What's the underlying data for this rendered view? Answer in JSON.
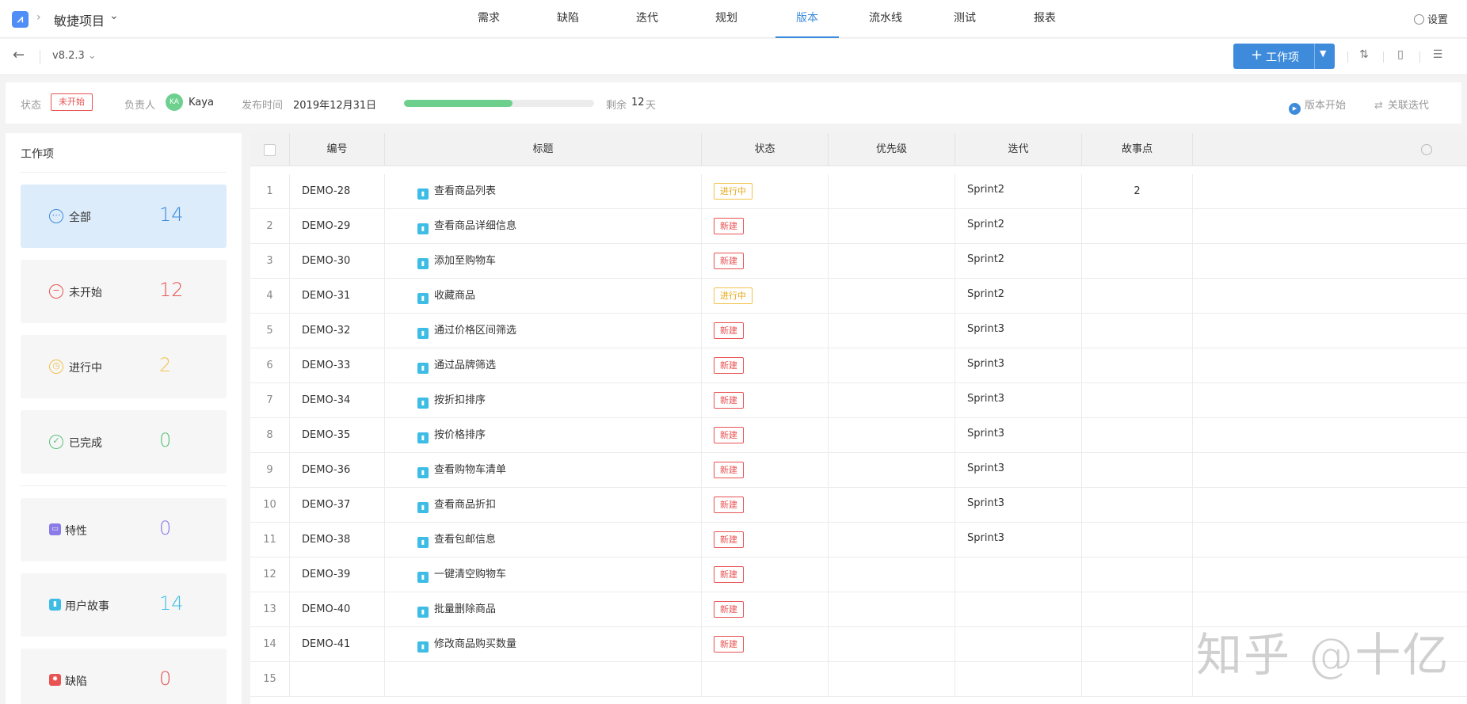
{
  "project": {
    "name": "敏捷项目"
  },
  "nav": [
    "需求",
    "缺陷",
    "迭代",
    "规划",
    "版本",
    "流水线",
    "测试",
    "报表"
  ],
  "nav_active": "版本",
  "settings_label": "设置",
  "version": {
    "label": "v8.2.3"
  },
  "toolbar": {
    "add_workitem_label": "工作项"
  },
  "info": {
    "status_label": "状态",
    "status_value": "未开始",
    "owner_label": "负责人",
    "owner_initials": "KA",
    "owner_name": "Kaya",
    "release_label": "发布时间",
    "release_date": "2019年12月31日",
    "progress": 0.57,
    "remaining_prefix": "剩余",
    "remaining_value": "12",
    "remaining_unit": "天",
    "start_action": "版本开始",
    "link_action": "关联迭代"
  },
  "left": {
    "title": "工作项",
    "cards": [
      {
        "label": "全部",
        "count": "14",
        "icon": "more-circle-icon",
        "color": "#3d8bda"
      },
      {
        "label": "未开始",
        "count": "12",
        "icon": "minus-circle-icon",
        "color": "#e85252"
      },
      {
        "label": "进行中",
        "count": "2",
        "icon": "clock-icon",
        "color": "#f2c34b"
      },
      {
        "label": "已完成",
        "count": "0",
        "icon": "check-circle-icon",
        "color": "#5cc27c"
      },
      {
        "label": "特性",
        "count": "0",
        "icon": "feature-icon",
        "color": "#8a7be8"
      },
      {
        "label": "用户故事",
        "count": "14",
        "icon": "story-icon",
        "color": "#3dbde6"
      },
      {
        "label": "缺陷",
        "count": "0",
        "icon": "bug-icon",
        "color": "#e85252"
      }
    ]
  },
  "table": {
    "headers": [
      "编号",
      "标题",
      "状态",
      "优先级",
      "迭代",
      "故事点"
    ],
    "rows": [
      {
        "n": "1",
        "id": "DEMO-28",
        "title": "查看商品列表",
        "status": "进行中",
        "iter": "Sprint2",
        "points": "2"
      },
      {
        "n": "2",
        "id": "DEMO-29",
        "title": "查看商品详细信息",
        "status": "新建",
        "iter": "Sprint2",
        "points": ""
      },
      {
        "n": "3",
        "id": "DEMO-30",
        "title": "添加至购物车",
        "status": "新建",
        "iter": "Sprint2",
        "points": ""
      },
      {
        "n": "4",
        "id": "DEMO-31",
        "title": "收藏商品",
        "status": "进行中",
        "iter": "Sprint2",
        "points": ""
      },
      {
        "n": "5",
        "id": "DEMO-32",
        "title": "通过价格区间筛选",
        "status": "新建",
        "iter": "Sprint3",
        "points": ""
      },
      {
        "n": "6",
        "id": "DEMO-33",
        "title": "通过品牌筛选",
        "status": "新建",
        "iter": "Sprint3",
        "points": ""
      },
      {
        "n": "7",
        "id": "DEMO-34",
        "title": "按折扣排序",
        "status": "新建",
        "iter": "Sprint3",
        "points": ""
      },
      {
        "n": "8",
        "id": "DEMO-35",
        "title": "按价格排序",
        "status": "新建",
        "iter": "Sprint3",
        "points": ""
      },
      {
        "n": "9",
        "id": "DEMO-36",
        "title": "查看购物车清单",
        "status": "新建",
        "iter": "Sprint3",
        "points": ""
      },
      {
        "n": "10",
        "id": "DEMO-37",
        "title": "查看商品折扣",
        "status": "新建",
        "iter": "Sprint3",
        "points": ""
      },
      {
        "n": "11",
        "id": "DEMO-38",
        "title": "查看包邮信息",
        "status": "新建",
        "iter": "Sprint3",
        "points": ""
      },
      {
        "n": "12",
        "id": "DEMO-39",
        "title": "一键清空购物车",
        "status": "新建",
        "iter": "",
        "points": ""
      },
      {
        "n": "13",
        "id": "DEMO-40",
        "title": "批量删除商品",
        "status": "新建",
        "iter": "",
        "points": ""
      },
      {
        "n": "14",
        "id": "DEMO-41",
        "title": "修改商品购买数量",
        "status": "新建",
        "iter": "",
        "points": ""
      },
      {
        "n": "15",
        "id": "",
        "title": "",
        "status": "",
        "iter": "",
        "points": ""
      }
    ]
  },
  "watermark": "知乎 @十亿"
}
